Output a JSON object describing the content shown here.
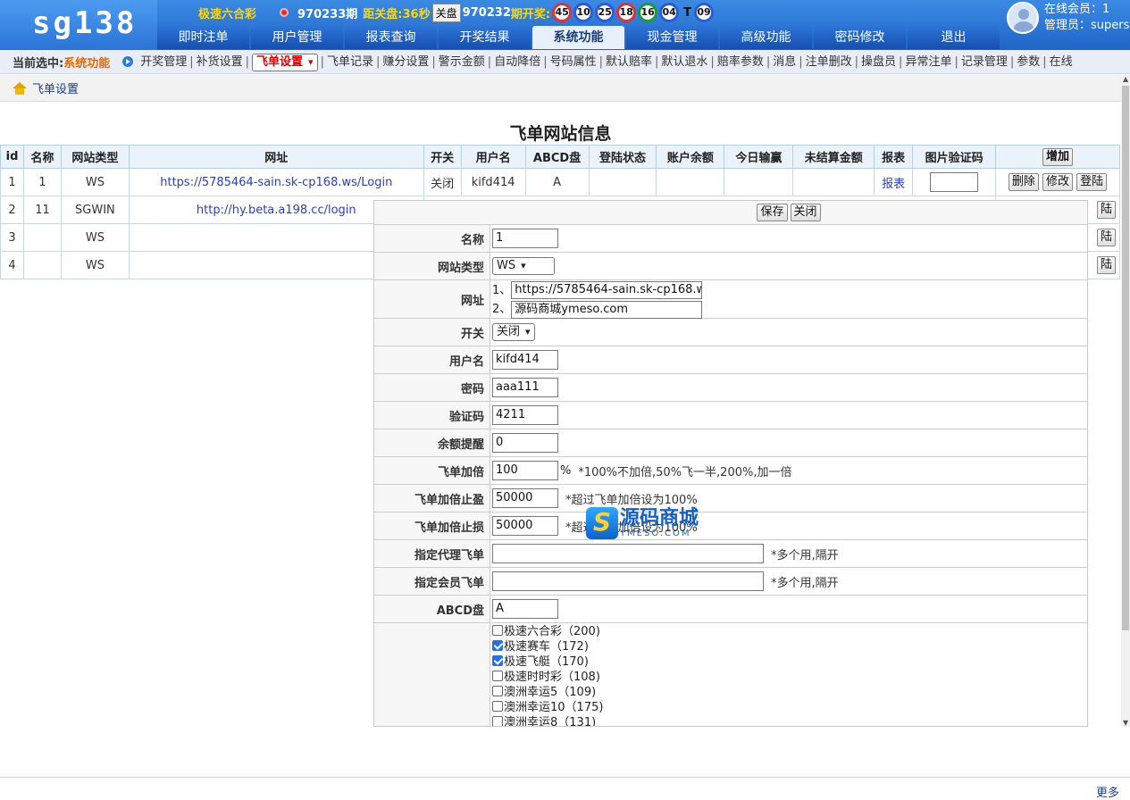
{
  "header": {
    "logo": "sg138",
    "lottery": "极速六合彩",
    "period": "970233期",
    "countdown_label": "距关盘:",
    "countdown": "36秒",
    "close_btn": "关盘",
    "last_period": "970232",
    "draw_label": "期开奖:",
    "balls": [
      "45",
      "10",
      "25",
      "18",
      "16",
      "04"
    ],
    "t_label": "T",
    "t_ball": "09",
    "nav": [
      "即时注单",
      "用户管理",
      "报表查询",
      "开奖结果",
      "系统功能",
      "现金管理",
      "高级功能",
      "密码修改",
      "退出"
    ],
    "online": "在线会员：1",
    "admin": "管理员：supers"
  },
  "subnav": {
    "label": "当前选中:",
    "current": "系统功能",
    "items": [
      "开奖管理",
      "补货设置",
      "飞单设置",
      "飞单记录",
      "赚分设置",
      "警示金额",
      "自动降倍",
      "号码属性",
      "默认赔率",
      "默认退水",
      "赔率参数",
      "消息",
      "注单删改",
      "操盘员",
      "异常注单",
      "记录管理",
      "参数",
      "在线"
    ],
    "selected_index": 2
  },
  "breadcrumb": "飞单设置",
  "page_title": "飞单网站信息",
  "table": {
    "headers": [
      "id",
      "名称",
      "网站类型",
      "网址",
      "开关",
      "用户名",
      "ABCD盘",
      "登陆状态",
      "账户余额",
      "今日输赢",
      "未结算金额",
      "报表",
      "图片验证码"
    ],
    "add": "增加",
    "rows": [
      {
        "id": "1",
        "name": "1",
        "type": "WS",
        "url": "https://5785464-sain.sk-cp168.ws/Login",
        "switch": "关闭",
        "user": "kifd414",
        "abcd": "A",
        "report": "报表"
      },
      {
        "id": "2",
        "name": "11",
        "type": "SGWIN",
        "url": "http://hy.beta.a198.cc/login"
      },
      {
        "id": "3",
        "name": "",
        "type": "WS",
        "url": ""
      },
      {
        "id": "4",
        "name": "",
        "type": "WS",
        "url": ""
      }
    ],
    "actions": [
      "删除",
      "修改",
      "登陆"
    ]
  },
  "form": {
    "save": "保存",
    "close": "关闭",
    "labels": {
      "name": "名称",
      "type": "网站类型",
      "url": "网址",
      "switch": "开关",
      "user": "用户名",
      "pwd": "密码",
      "code": "验证码",
      "bal": "余额提醒",
      "mult": "飞单加倍",
      "win": "飞单加倍止盈",
      "loss": "飞单加倍止损",
      "agent": "指定代理飞单",
      "member": "指定会员飞单",
      "abcd": "ABCD盘"
    },
    "values": {
      "name": "1",
      "type": "WS",
      "url1_idx": "1、",
      "url1": "https://5785464-sain.sk-cp168.ws/",
      "url2_idx": "2、",
      "url2": "源码商城ymeso.com",
      "switch": "关闭",
      "user": "kifd414",
      "pwd": "aaa111",
      "code": "4211",
      "bal": "0",
      "mult": "100",
      "win": "50000",
      "loss": "50000",
      "agent": "",
      "member": "",
      "abcd": "A"
    },
    "hints": {
      "mult_unit": "%",
      "mult": "*100%不加倍,50%飞一半,200%,加一倍",
      "win": "*超过飞单加倍设为100%",
      "loss": "*超过飞单加倍设为100%",
      "agent": "*多个用,隔开",
      "member": "*多个用,隔开"
    },
    "games": [
      {
        "label": "极速六合彩（200)",
        "on": false
      },
      {
        "label": "极速赛车（172)",
        "on": true
      },
      {
        "label": "极速飞艇（170)",
        "on": true
      },
      {
        "label": "极速时时彩（108)",
        "on": false
      },
      {
        "label": "澳洲幸运5（109)",
        "on": false
      },
      {
        "label": "澳洲幸运10（175)",
        "on": false
      },
      {
        "label": "澳洲幸运8（131)",
        "on": false
      }
    ]
  },
  "watermark": {
    "text": "源码商城",
    "sub": "YMESO.COM"
  },
  "footer": {
    "more": "更多"
  }
}
